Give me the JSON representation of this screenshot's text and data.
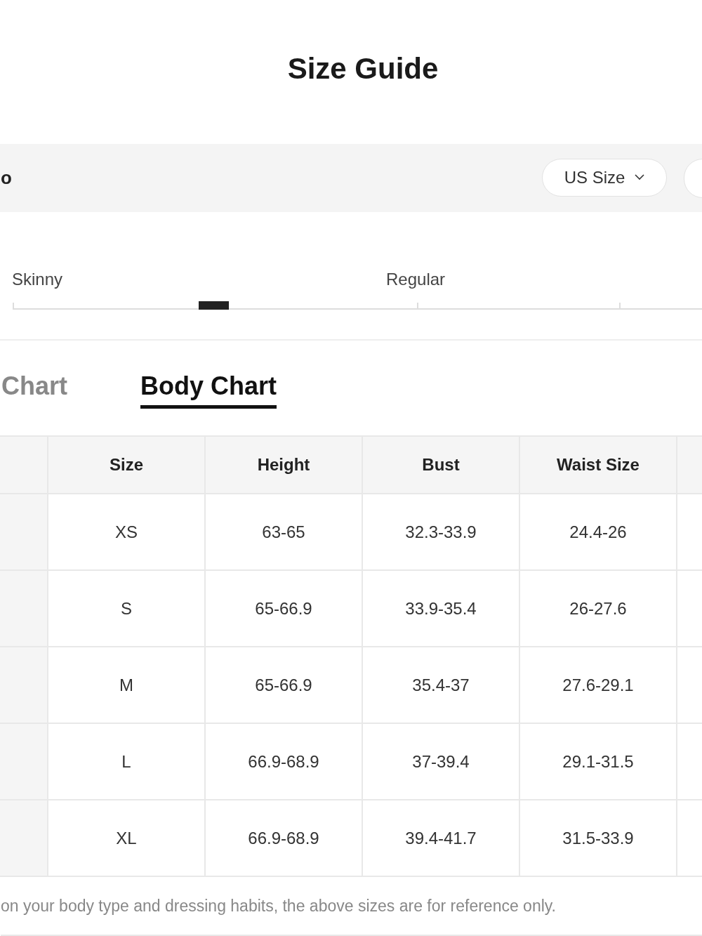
{
  "title": "Size Guide",
  "toolbar": {
    "label": "o",
    "unit_select": {
      "value": "US Size"
    }
  },
  "fit_slider": {
    "labels": [
      "Skinny",
      "Regular"
    ],
    "level": 0.27
  },
  "tabs": [
    {
      "label": "Chart",
      "selected": false
    },
    {
      "label": "Body Chart",
      "selected": true
    }
  ],
  "table": {
    "columns": [
      "Size",
      "Height",
      "Bust",
      "Waist Size"
    ],
    "rows": [
      [
        "XS",
        "63-65",
        "32.3-33.9",
        "24.4-26"
      ],
      [
        "S",
        "65-66.9",
        "33.9-35.4",
        "26-27.6"
      ],
      [
        "M",
        "65-66.9",
        "35.4-37",
        "27.6-29.1"
      ],
      [
        "L",
        "66.9-68.9",
        "37-39.4",
        "29.1-31.5"
      ],
      [
        "XL",
        "66.9-68.9",
        "39.4-41.7",
        "31.5-33.9"
      ]
    ]
  },
  "note": "on your body type and dressing habits, the above sizes are for reference only."
}
